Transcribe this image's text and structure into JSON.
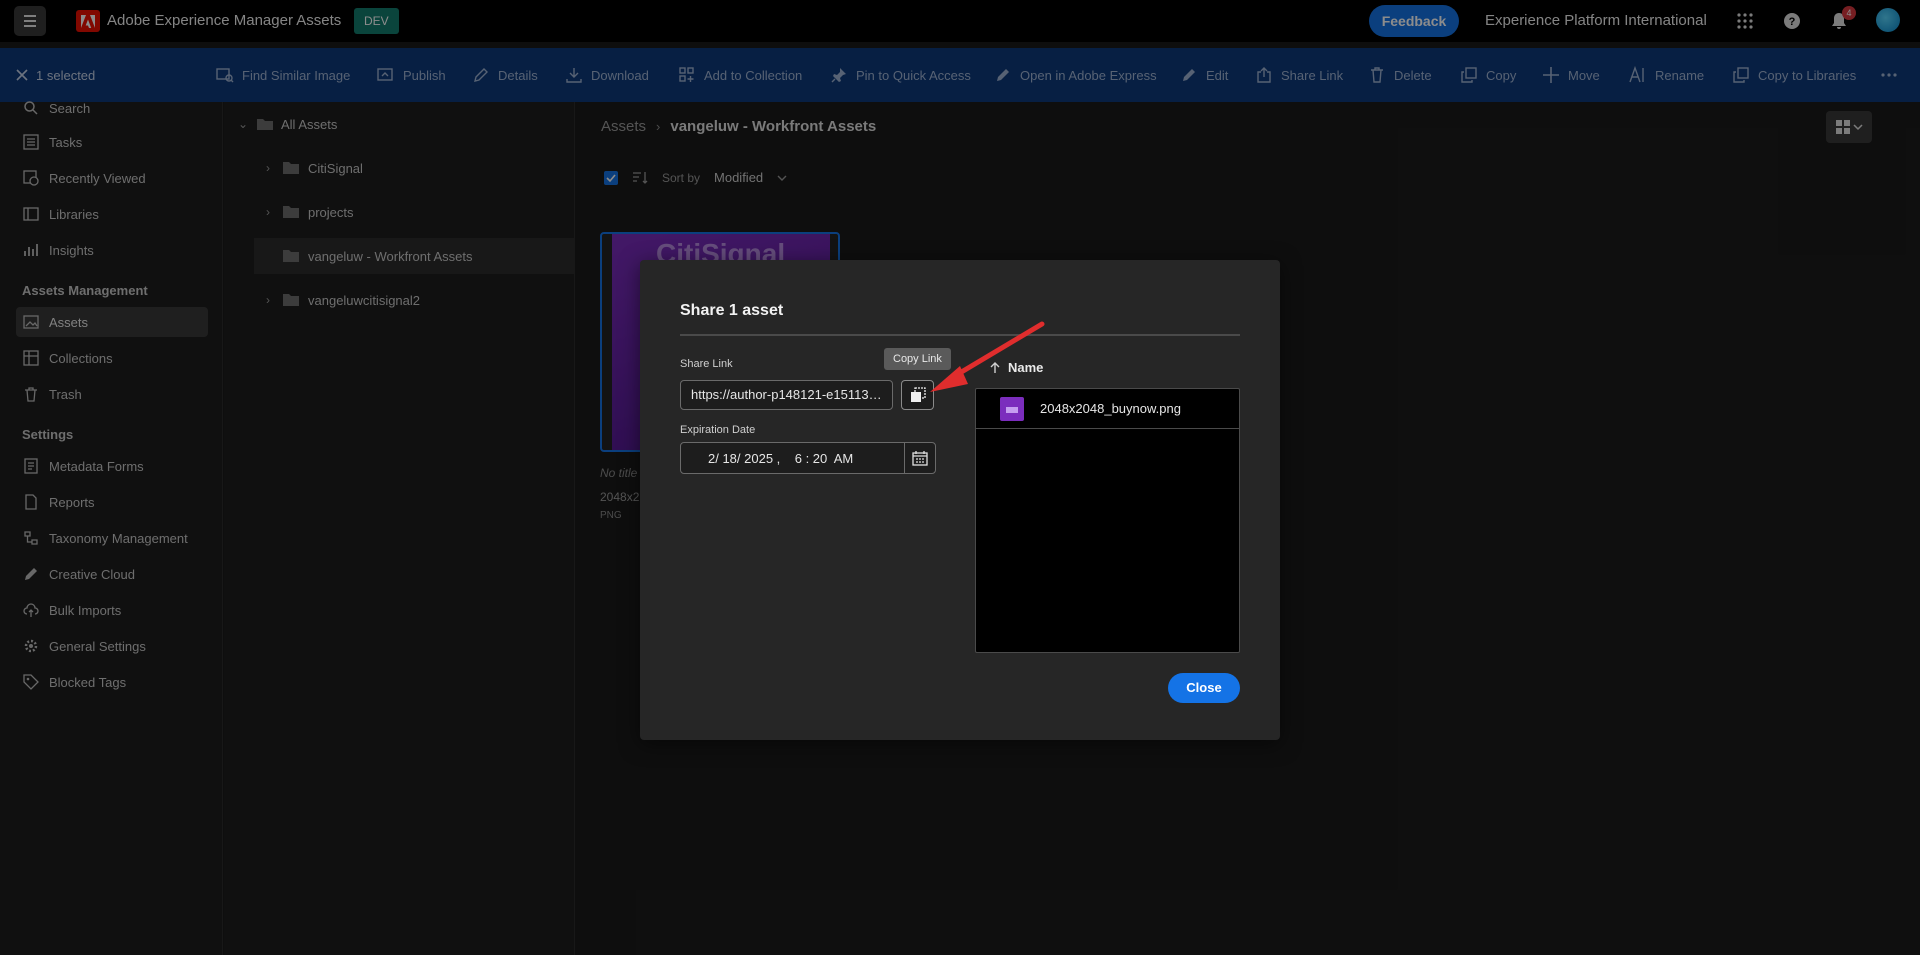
{
  "header": {
    "app_title": "Adobe Experience Manager Assets",
    "env_badge": "DEV",
    "feedback_label": "Feedback",
    "org_name": "Experience Platform International",
    "notification_count": "4",
    "brand_color": "#eb1000",
    "accent_color": "#1473e6"
  },
  "actionbar": {
    "selected_label": "1 selected",
    "actions": [
      {
        "label": "Find Similar Image",
        "icon": "image-search-icon"
      },
      {
        "label": "Publish",
        "icon": "publish-icon"
      },
      {
        "label": "Details",
        "icon": "edit-details-icon"
      },
      {
        "label": "Download",
        "icon": "download-icon"
      },
      {
        "label": "Add to Collection",
        "icon": "add-to-collection-icon"
      },
      {
        "label": "Pin to Quick Access",
        "icon": "pin-icon"
      },
      {
        "label": "Open in Adobe Express",
        "icon": "express-icon"
      },
      {
        "label": "Edit",
        "icon": "pencil-icon"
      },
      {
        "label": "Share Link",
        "icon": "share-icon"
      },
      {
        "label": "Delete",
        "icon": "trash-icon"
      },
      {
        "label": "Copy",
        "icon": "copy-icon"
      },
      {
        "label": "Move",
        "icon": "move-icon"
      },
      {
        "label": "Rename",
        "icon": "rename-icon"
      },
      {
        "label": "Copy to Libraries",
        "icon": "copy-to-libraries-icon"
      }
    ]
  },
  "leftnav": {
    "items_top": [
      "Search",
      "Tasks",
      "Recently Viewed",
      "Libraries",
      "Insights"
    ],
    "section_assets": "Assets Management",
    "items_assets": [
      "Assets",
      "Collections",
      "Trash"
    ],
    "section_settings": "Settings",
    "items_settings": [
      "Metadata Forms",
      "Reports",
      "Taxonomy Management",
      "Creative Cloud",
      "Bulk Imports",
      "General Settings",
      "Blocked Tags"
    ]
  },
  "tree": {
    "root": "All Assets",
    "folders": [
      "CitiSignal",
      "projects",
      "vangeluw - Workfront Assets",
      "vangeluwcitisignal2"
    ]
  },
  "content": {
    "breadcrumb_root": "Assets",
    "breadcrumb_current": "vangeluw - Workfront Assets",
    "sort_by_label": "Sort by",
    "sort_value": "Modified",
    "card": {
      "thumb_text": "CitiSignal",
      "title": "No title",
      "name": "2048x2",
      "type": "PNG"
    }
  },
  "dialog": {
    "title": "Share 1 asset",
    "share_link_label": "Share Link",
    "share_link_value": "https://author-p148121-e151139...",
    "copy_tooltip": "Copy Link",
    "expiration_label": "Expiration Date",
    "expiration_value": "2/ 18/ 2025 ,    6 : 20  AM",
    "name_header": "Name",
    "files": [
      "2048x2048_buynow.png"
    ],
    "close_label": "Close"
  }
}
